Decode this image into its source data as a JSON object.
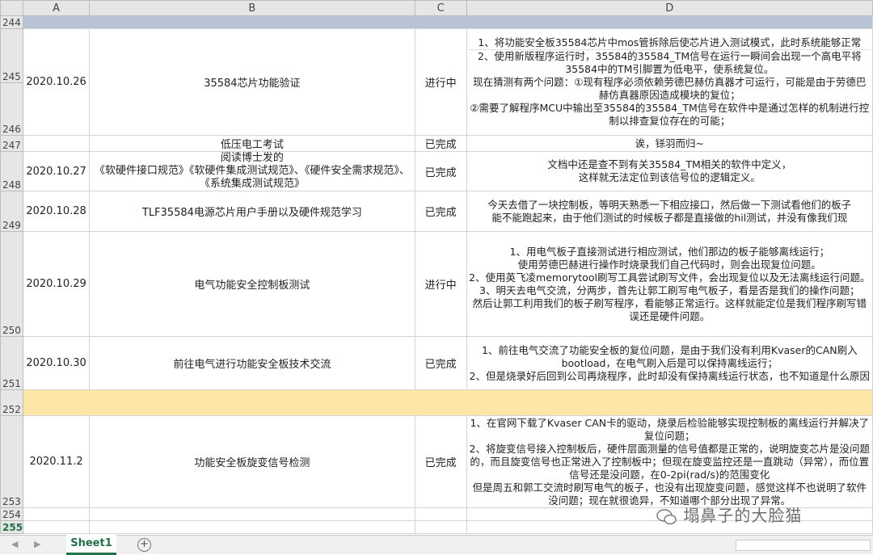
{
  "columns": [
    "A",
    "B",
    "C",
    "D"
  ],
  "rows": [
    {
      "num": "244"
    },
    {
      "date": "2020.10.26",
      "task": "35584芯片功能验证",
      "status": "进行中",
      "desc": [
        "1、将功能安全板35584芯片中mos管拆除后使芯片进入测试模式，此时系统能够正常",
        "2、使用新版程序运行时，35584的35584_TM信号在运行一瞬间会出现一个高电平将35584中的TM引脚置为低电平，使系统复位。",
        "现在猜测有两个问题：①现有程序必须依赖劳德巴赫仿真器才可运行，可能是由于劳德巴赫仿真器原因造成模块的复位；",
        "②需要了解程序MCU中输出至35584的35584_TM信号在软件中是通过怎样的机制进行控制以排查复位存在的可能；"
      ],
      "nums": [
        "245",
        "246"
      ]
    },
    {
      "num": "247",
      "task": "低压电工考试",
      "status": "已完成",
      "desc": [
        "诶，铩羽而归~"
      ]
    },
    {
      "num": "248",
      "date": "2020.10.27",
      "task_lines": [
        "阅读博士发的",
        "《软硬件接口规范》《软硬件集成测试规范》、《硬件安全需求规范》、《系统集成测试规范》"
      ],
      "status": "已完成",
      "desc": [
        "文档中还是查不到有关35584_TM相关的软件中定义，",
        "这样就无法定位到该信号位的逻辑定义。"
      ]
    },
    {
      "num": "249",
      "date": "2020.10.28",
      "task": "TLF35584电源芯片用户手册以及硬件规范学习",
      "status": "已完成",
      "desc": [
        "今天去借了一块控制板，等明天熟悉一下相应接口，然后做一下测试看他们的板子",
        "能不能跑起来，由于他们测试的时候板子都是直接做的hil测试，并没有像我们现"
      ]
    },
    {
      "num": "250",
      "date": "2020.10.29",
      "task": "电气功能安全控制板测试",
      "status": "进行中",
      "desc": [
        "1、用电气板子直接测试进行相应测试，他们那边的板子能够离线运行；",
        "使用劳德巴赫进行操作时烧录我们自己代码时，则会出现复位问题。",
        "2、使用英飞凌memorytool刷写工具尝试刷写文件，会出现复位以及无法离线运行问题。",
        "3、明天去电气交流，分两步，首先让郭工刷写电气板子，看是否是我们的操作问题；",
        "然后让郭工利用我们的板子刷写程序，看能够正常运行。这样就能定位是我们程序刷写错误还是硬件问题。"
      ]
    },
    {
      "num": "251",
      "date": "2020.10.30",
      "task": "前往电气进行功能安全板技术交流",
      "status": "已完成",
      "desc": [
        "1、前往电气交流了功能安全板的复位问题，是由于我们没有利用Kvaser的CAN刷入bootload，在电气刷入后是可以保持离线运行；",
        "2、但是烧录好后回到公司再烧程序，此时却没有保持离线运行状态，也不知道是什么原因"
      ]
    },
    {
      "num": "252"
    },
    {
      "num": "253",
      "date": "2020.11.2",
      "task": "功能安全板旋变信号检测",
      "status": "已完成",
      "desc": [
        "1、在官网下载了Kvaser CAN卡的驱动，烧录后检验能够实现控制板的离线运行并解决了复位问题；",
        "2、将旋变信号接入控制板后，硬件层面测量的信号值都是正常的，说明旋变芯片是没问题的，而且旋变信号也正常进入了控制板中；但现在旋变监控还是一直跳动（异常），而位置信号还是没问题，在0-2pi(rad/s)的范围变化",
        "但是周五和郭工交流时刷写电气的板子，也没有出现旋变问题，感觉这样不也说明了软件没问题；现在就很诡异，不知道哪个部分出现了异常。"
      ]
    },
    {
      "num": "254"
    },
    {
      "num": "255"
    }
  ],
  "sheet_tab": "Sheet1",
  "add_sheet": "+",
  "nav_prev": "◀",
  "nav_next": "▶",
  "watermark": "塌鼻子的大脸猫",
  "colors": {
    "gray_row": "#b8c4d6",
    "yellow_row": "#fde6a6",
    "accent": "#217346"
  }
}
